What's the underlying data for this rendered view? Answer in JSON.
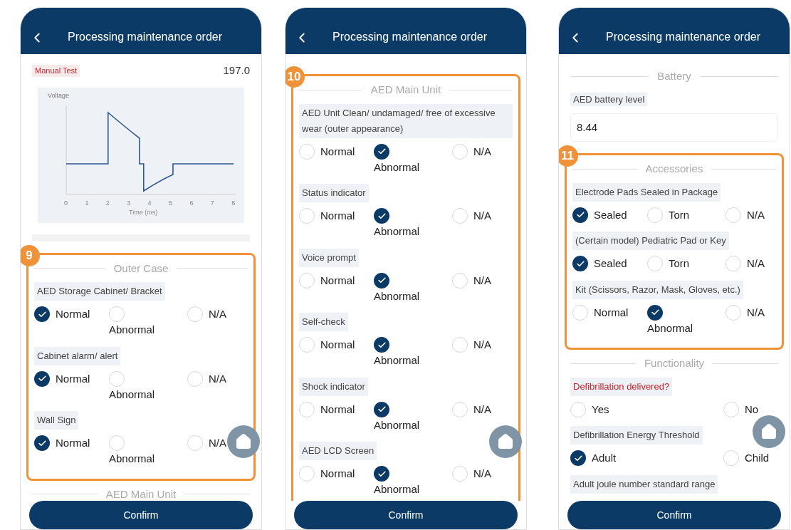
{
  "phones": [
    {
      "title": "Processing maintenance order",
      "confirm": "Confirm",
      "blocks": [
        {
          "kind": "reading",
          "label": "Manual Test",
          "value": "197.0",
          "waveform": {
            "ylabel": "Voltage",
            "xlabel": "Time (ms)",
            "xticks": [
              "0",
              "1",
              "2",
              "3",
              "4",
              "5",
              "6",
              "7",
              "8"
            ]
          }
        },
        {
          "kind": "section",
          "title": "Outer Case",
          "callout": "9",
          "children": [
            {
              "kind": "question",
              "label": "AED Storage Cabinet/ Bracket",
              "alert": false,
              "options": [
                {
                  "label": "Normal",
                  "selected": true
                },
                {
                  "label": "Abnormal",
                  "selected": false
                },
                {
                  "label": "N/A",
                  "selected": false
                }
              ]
            },
            {
              "kind": "question",
              "label": "Cabinet alarm/ alert",
              "alert": false,
              "options": [
                {
                  "label": "Normal",
                  "selected": true
                },
                {
                  "label": "Abnormal",
                  "selected": false
                },
                {
                  "label": "N/A",
                  "selected": false
                }
              ]
            },
            {
              "kind": "question",
              "label": "Wall Sign",
              "alert": false,
              "options": [
                {
                  "label": "Normal",
                  "selected": true
                },
                {
                  "label": "Abnormal",
                  "selected": false
                },
                {
                  "label": "N/A",
                  "selected": false
                }
              ]
            }
          ]
        },
        {
          "kind": "section",
          "title": "AED Main Unit"
        }
      ]
    },
    {
      "title": "Processing maintenance order",
      "confirm": "Confirm",
      "blocks": [
        {
          "kind": "section",
          "title": "AED Main Unit",
          "callout": "10",
          "children": [
            {
              "kind": "question",
              "label": "AED Unit Clean/ undamaged/ free of excessive wear (outer appearance)",
              "alert": false,
              "options": [
                {
                  "label": "Normal",
                  "selected": false
                },
                {
                  "label": "Abnormal",
                  "selected": true
                },
                {
                  "label": "N/A",
                  "selected": false
                }
              ]
            },
            {
              "kind": "question",
              "label": "Status indicator",
              "alert": false,
              "options": [
                {
                  "label": "Normal",
                  "selected": false
                },
                {
                  "label": "Abnormal",
                  "selected": true
                },
                {
                  "label": "N/A",
                  "selected": false
                }
              ]
            },
            {
              "kind": "question",
              "label": "Voice prompt",
              "alert": false,
              "options": [
                {
                  "label": "Normal",
                  "selected": false
                },
                {
                  "label": "Abnormal",
                  "selected": true
                },
                {
                  "label": "N/A",
                  "selected": false
                }
              ]
            },
            {
              "kind": "question",
              "label": "Self-check",
              "alert": false,
              "options": [
                {
                  "label": "Normal",
                  "selected": false
                },
                {
                  "label": "Abnormal",
                  "selected": true
                },
                {
                  "label": "N/A",
                  "selected": false
                }
              ]
            },
            {
              "kind": "question",
              "label": "Shock indicator",
              "alert": false,
              "options": [
                {
                  "label": "Normal",
                  "selected": false
                },
                {
                  "label": "Abnormal",
                  "selected": true
                },
                {
                  "label": "N/A",
                  "selected": false
                }
              ]
            },
            {
              "kind": "question",
              "label": "AED LCD Screen",
              "alert": false,
              "options": [
                {
                  "label": "Normal",
                  "selected": false
                },
                {
                  "label": "Abnormal",
                  "selected": true
                },
                {
                  "label": "N/A",
                  "selected": false
                }
              ]
            }
          ]
        }
      ]
    },
    {
      "title": "Processing maintenance order",
      "confirm": "Confirm",
      "blocks": [
        {
          "kind": "section",
          "title": "Battery",
          "children": [
            {
              "kind": "field",
              "label": "AED battery level",
              "value": "8.44"
            }
          ]
        },
        {
          "kind": "section",
          "title": "Accessories",
          "callout": "11",
          "children": [
            {
              "kind": "question",
              "label": "Electrode Pads Sealed in Package",
              "alert": false,
              "options": [
                {
                  "label": "Sealed",
                  "selected": true
                },
                {
                  "label": "Torn",
                  "selected": false
                },
                {
                  "label": "N/A",
                  "selected": false
                }
              ]
            },
            {
              "kind": "question",
              "label": "(Certain model) Pediatric Pad or Key",
              "alert": false,
              "options": [
                {
                  "label": "Sealed",
                  "selected": true
                },
                {
                  "label": "Torn",
                  "selected": false
                },
                {
                  "label": "N/A",
                  "selected": false
                }
              ]
            },
            {
              "kind": "question",
              "label": "Kit (Scissors, Razor, Mask, Gloves, etc.)",
              "alert": false,
              "options": [
                {
                  "label": "Normal",
                  "selected": false
                },
                {
                  "label": "Abnormal",
                  "selected": true
                },
                {
                  "label": "N/A",
                  "selected": false
                }
              ]
            }
          ]
        },
        {
          "kind": "section",
          "title": "Functionality",
          "children": [
            {
              "kind": "question",
              "label": "Defibrillation delivered?",
              "alert": true,
              "options": [
                {
                  "label": "Yes",
                  "selected": false
                },
                {
                  "label": "No",
                  "selected": false
                }
              ]
            },
            {
              "kind": "question",
              "label": "Defibrillation Energy Threshold",
              "alert": false,
              "options": [
                {
                  "label": "Adult",
                  "selected": true
                },
                {
                  "label": "Child",
                  "selected": false
                }
              ]
            },
            {
              "kind": "question",
              "label": "Adult joule number standard range",
              "alert": false
            }
          ]
        }
      ]
    }
  ]
}
